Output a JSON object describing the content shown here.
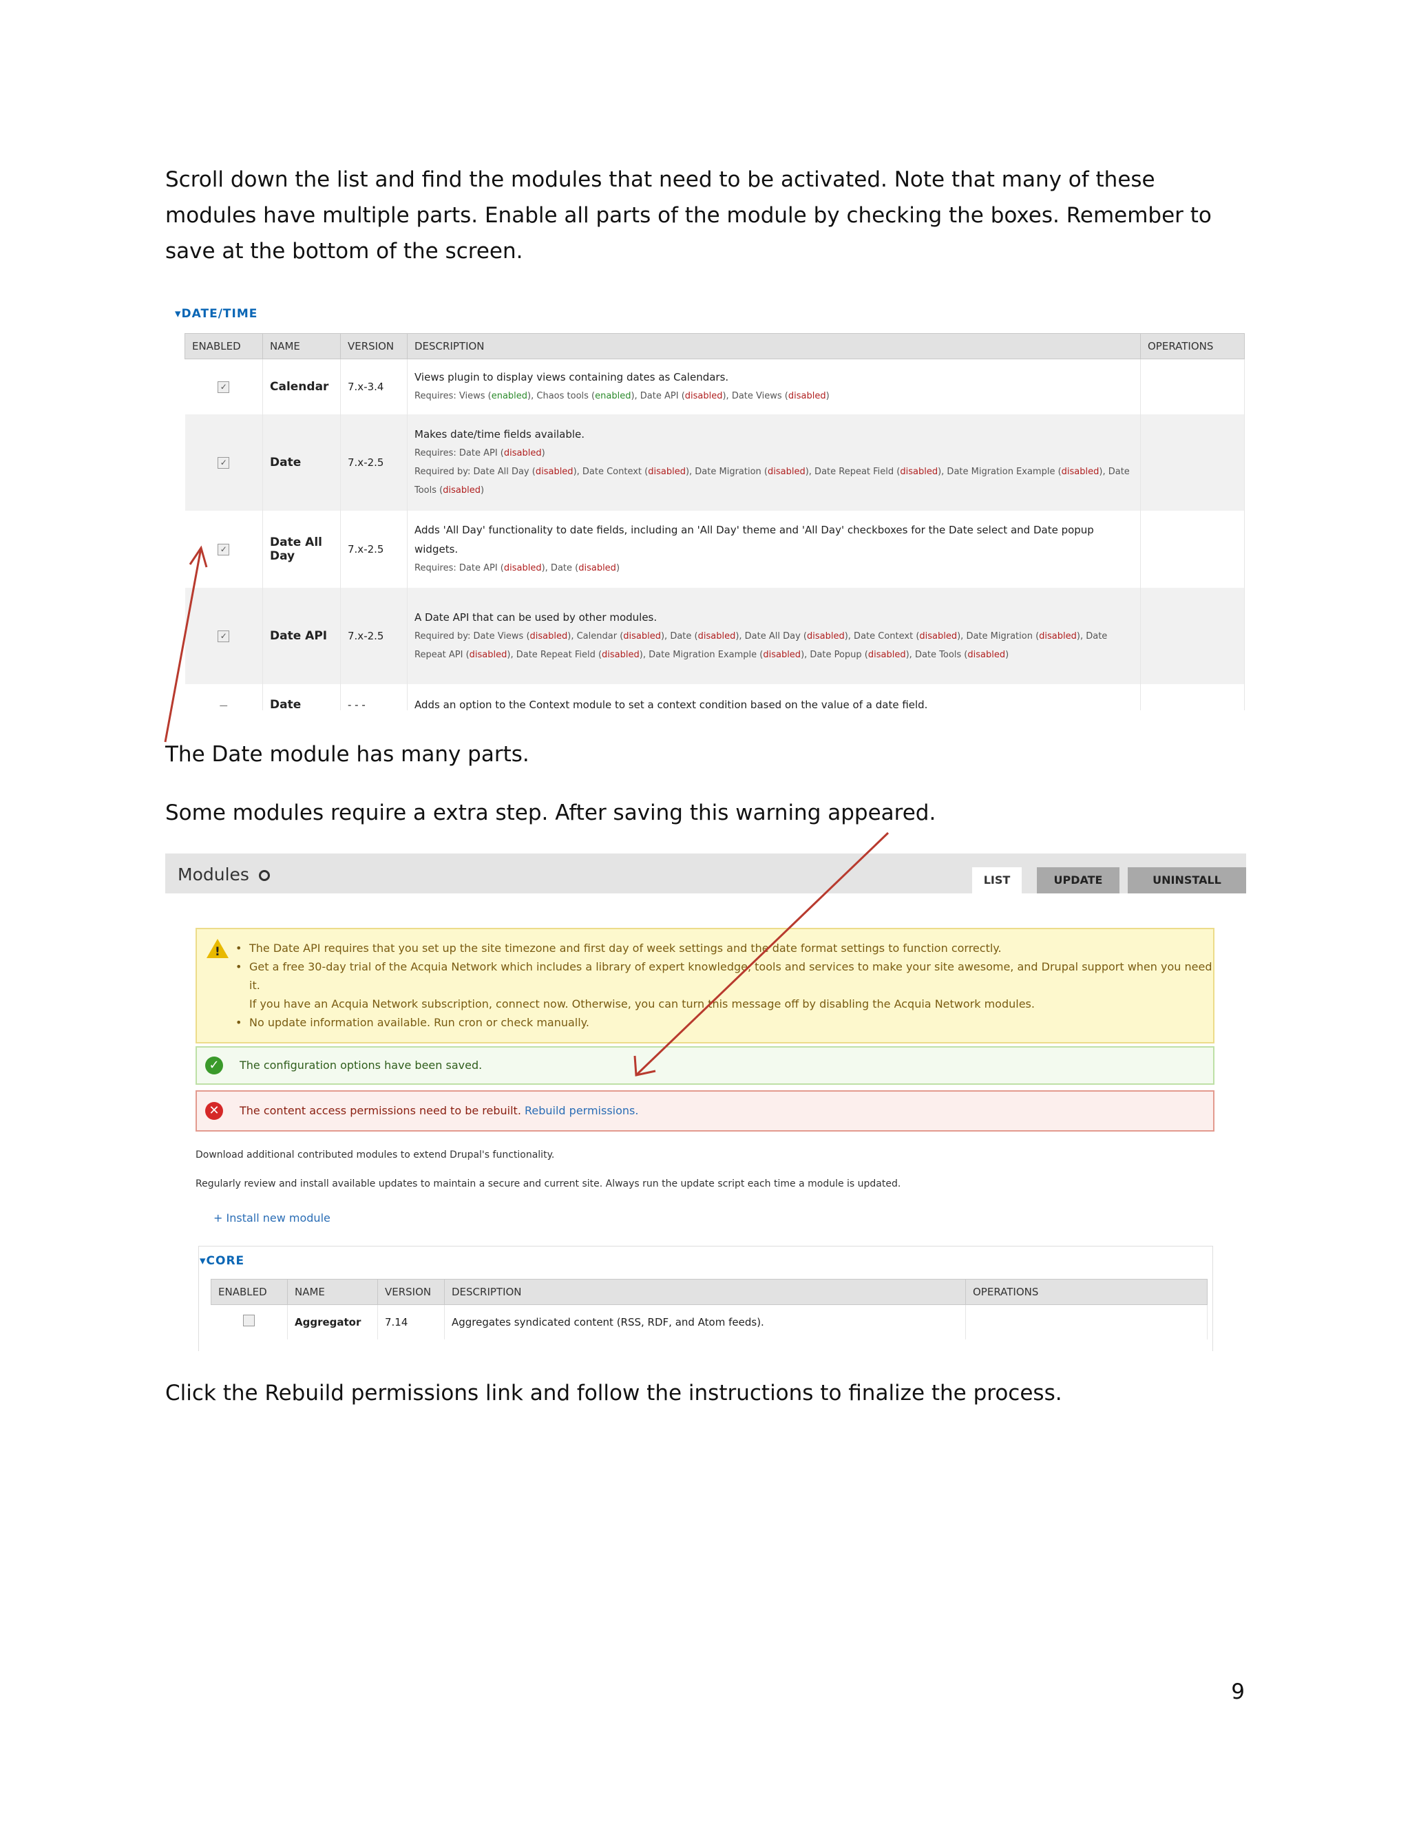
{
  "text": {
    "p1": "Scroll down the list and find the modules that need to be activated.  Note that many of these modules have multiple parts.  Enable all parts of the module by checking the boxes. Remember to save at the bottom of the screen.",
    "p2": "The Date module has many parts.",
    "p3": "Some modules require a extra step.  After saving this warning appeared.",
    "p4": "Click the Rebuild permissions link and follow the instructions to finalize the process.",
    "page_number": "9"
  },
  "shot1": {
    "group_title": "▾DATE/TIME",
    "headers": {
      "enabled": "ENABLED",
      "name": "NAME",
      "version": "VERSION",
      "description": "DESCRIPTION",
      "operations": "OPERATIONS"
    },
    "rows": [
      {
        "name": "Calendar",
        "version": "7.x-3.4",
        "checked": true,
        "description": "Views plugin to display views containing dates as Calendars.",
        "req1": "Requires: Views (enabled), Chaos tools (enabled), Date API (disabled), Date Views (disabled)"
      },
      {
        "name": "Date",
        "version": "7.x-2.5",
        "checked": true,
        "description": "Makes date/time fields available.",
        "req1": "Requires: Date API (disabled)",
        "req2": "Required by: Date All Day (disabled), Date Context (disabled), Date Migration (disabled), Date Repeat Field (disabled), Date Migration Example (disabled), Date Tools (disabled)"
      },
      {
        "name": "Date All Day",
        "version": "7.x-2.5",
        "checked": true,
        "description": "Adds 'All Day' functionality to date fields, including an 'All Day' theme and 'All Day' checkboxes for the Date select and Date popup widgets.",
        "req1": "Requires: Date API (disabled), Date (disabled)"
      },
      {
        "name": "Date API",
        "version": "7.x-2.5",
        "checked": true,
        "description": "A Date API that can be used by other modules.",
        "req1": "Required by: Date Views (disabled), Calendar (disabled), Date (disabled), Date All Day (disabled), Date Context (disabled), Date Migration (disabled), Date Repeat API (disabled), Date Repeat Field (disabled), Date Migration Example (disabled), Date Popup (disabled), Date Tools (disabled)"
      },
      {
        "name": "Date",
        "version": "- - -",
        "checked": false,
        "description": "Adds an option to the Context module to set a context condition based on the value of a date field."
      }
    ]
  },
  "shot2": {
    "page_title": "Modules",
    "tabs": [
      "LIST",
      "UPDATE",
      "UNINSTALL"
    ],
    "warning": [
      "The Date API requires that you set up the site timezone and first day of week settings and the date format settings to function correctly.",
      "Get a free 30-day trial of the Acquia Network which includes a library of expert knowledge, tools and services to make your site awesome, and Drupal support when you need it.",
      "If you have an Acquia Network subscription, connect now. Otherwise, you can turn this message off by disabling the Acquia Network modules.",
      "No update information available. Run cron or check manually."
    ],
    "status": "The configuration options have been saved.",
    "error": "The content access permissions need to be rebuilt.",
    "error_link": "Rebuild permissions.",
    "info1": "Download additional contributed modules to extend Drupal's functionality.",
    "info2": "Regularly review and install available updates to maintain a secure and current site. Always run the update script each time a module is updated.",
    "install": "+ Install new module",
    "core_title": "▾CORE",
    "core_headers": {
      "enabled": "ENABLED",
      "name": "NAME",
      "version": "VERSION",
      "description": "DESCRIPTION",
      "operations": "OPERATIONS"
    },
    "core_row": {
      "name": "Aggregator",
      "version": "7.14",
      "description": "Aggregates syndicated content (RSS, RDF, and Atom feeds)."
    }
  },
  "colors": {
    "link": "#2a6db5",
    "disabled": "#b02020",
    "enabled": "#2b8a2b",
    "arrow": "#b83a2e"
  }
}
